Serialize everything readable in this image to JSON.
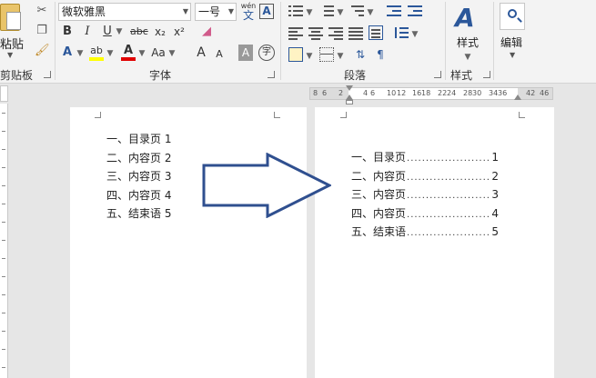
{
  "ribbon": {
    "clipboard": {
      "paste_label": "粘贴",
      "group_label": "剪贴板"
    },
    "font": {
      "font_name": "微软雅黑",
      "font_size": "一号",
      "phonetic_top": "wén",
      "phonetic_bottom": "文",
      "border_char": "A",
      "bold": "B",
      "italic": "I",
      "underline": "U",
      "strike": "abc",
      "subscript": "x₂",
      "superscript": "x²",
      "text_effect": "A",
      "highlight": "ab",
      "font_color": "A",
      "change_case": "Aa",
      "grow": "A",
      "shrink": "A",
      "shade_char": "A",
      "enclose_char": "字",
      "group_label": "字体"
    },
    "paragraph": {
      "group_label": "段落"
    },
    "styles": {
      "label": "样式",
      "group_label": "样式"
    },
    "editing": {
      "label": "编辑"
    }
  },
  "ruler": {
    "ticks": [
      "8",
      "6",
      "2",
      "4",
      "6",
      "10",
      "12",
      "16",
      "18",
      "22",
      "24",
      "28",
      "30",
      "34",
      "36",
      "42",
      "46"
    ]
  },
  "left_page": {
    "items": [
      "一、目录页 1",
      "二、内容页 2",
      "三、内容页 3",
      "四、内容页 4",
      "五、结束语 5"
    ]
  },
  "right_page": {
    "entries": [
      {
        "title": "一、目录页",
        "leader": "............................................",
        "page": "1"
      },
      {
        "title": "二、内容页",
        "leader": "............................................",
        "page": "2"
      },
      {
        "title": "三、内容页",
        "leader": "............................................",
        "page": "3"
      },
      {
        "title": "四、内容页",
        "leader": "............................................",
        "page": "4"
      },
      {
        "title": "五、结束语",
        "leader": "............................................",
        "page": "5"
      }
    ]
  },
  "colors": {
    "accent": "#2b579a",
    "arrow": "#2f4f8f",
    "highlight": "#ffff00",
    "font_red": "#e00000"
  }
}
